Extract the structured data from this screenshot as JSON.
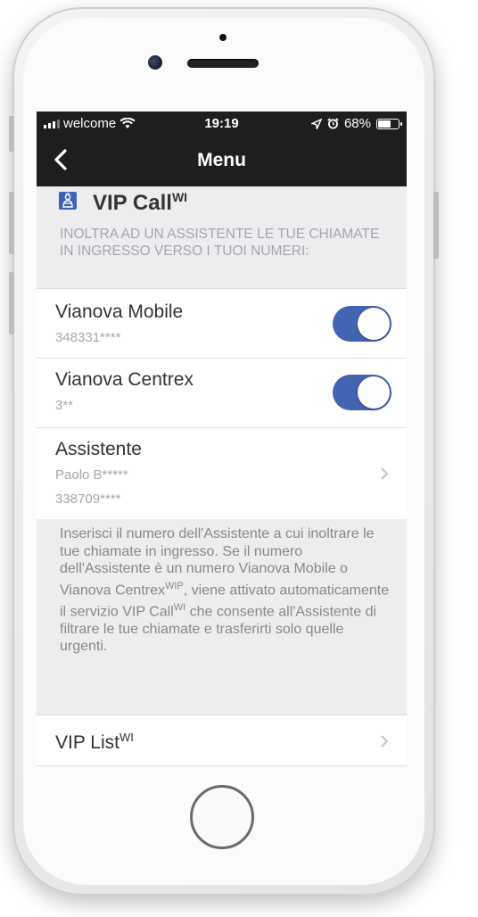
{
  "status_bar": {
    "carrier": "welcome",
    "time": "19:19",
    "battery": "68%",
    "battery_level": 0.68
  },
  "nav": {
    "title": "Menu",
    "back_icon": "chevron-left-icon"
  },
  "section": {
    "title": "VIP Call",
    "title_sup": "WI",
    "description": "INOLTRA AD UN ASSISTENTE LE TUE CHIAMATE IN INGRESSO VERSO I TUOI NUMERI:"
  },
  "rows": [
    {
      "title": "Vianova Mobile",
      "subtitle": "348331****",
      "toggle_on": true
    },
    {
      "title": "Vianova Centrex",
      "subtitle": "3**",
      "toggle_on": true
    }
  ],
  "assistant": {
    "title": "Assistente",
    "name": "Paolo B*****",
    "number": "338709****"
  },
  "footer": {
    "text_1": "Inserisci il numero dell'Assistente a cui inoltrare le tue chiamate in ingresso. Se il numero dell'Assistente è un numero Vianova Mobile o Vianova Centrex",
    "sup_1": "WIP",
    "text_2": ", viene attivato automaticamente il servizio VIP Call",
    "sup_2": "WI",
    "text_3": " che consente all'Assistente di filtrare le tue chiamate e trasferirti solo quelle urgenti."
  },
  "vip_list": {
    "title": "VIP List",
    "title_sup": "WI"
  },
  "colors": {
    "toggle_on": "#4364b1",
    "bar": "#1e1e1e",
    "group_bg": "#ededf0"
  }
}
